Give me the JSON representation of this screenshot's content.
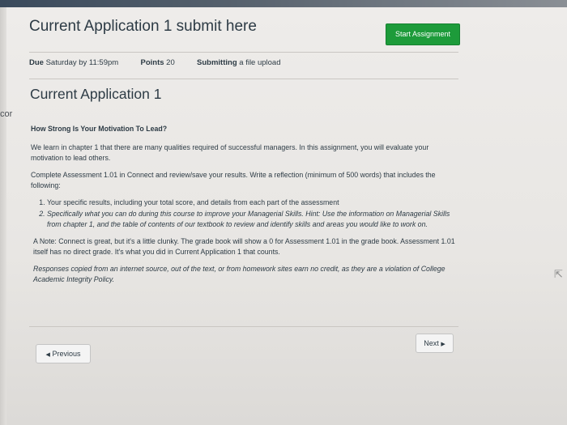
{
  "sidebar_fragment": "cor",
  "header": {
    "title": "Current Application 1 submit here",
    "start_button": "Start Assignment"
  },
  "meta": {
    "due_label": "Due",
    "due_value": "Saturday by 11:59pm",
    "points_label": "Points",
    "points_value": "20",
    "submitting_label": "Submitting",
    "submitting_value": "a file upload"
  },
  "assignment_title": "Current Application 1",
  "body": {
    "heading": "How Strong Is Your Motivation To Lead?",
    "p1": "We learn in chapter 1 that there are many qualities required of successful managers. In this assignment, you will evaluate your motivation to lead others.",
    "p2": "Complete Assessment 1.01 in Connect and review/save your results. Write a reflection (minimum of 500 words) that includes the following:",
    "list": [
      "Your specific results, including your total score, and details from each part of the assessment",
      "Specifically what you can do during this course to improve your Managerial Skills. Hint: Use the information on Managerial Skills from chapter 1, and the table of contents of our textbook to review and identify skills and areas you would like to work on."
    ],
    "note": "A Note: Connect is great, but it's a little clunky. The grade book will show a 0 for Assessment 1.01 in the grade book. Assessment 1.01 itself has no direct grade. It's what you did in Current Application 1 that counts.",
    "policy": "Responses copied from an internet source, out of the text, or from homework sites earn no credit, as they are a violation of College Academic Integrity Policy."
  },
  "nav": {
    "previous": "Previous",
    "next": "Next"
  },
  "colors": {
    "accent_green": "#1d9b3a",
    "text": "#2d3b45"
  }
}
